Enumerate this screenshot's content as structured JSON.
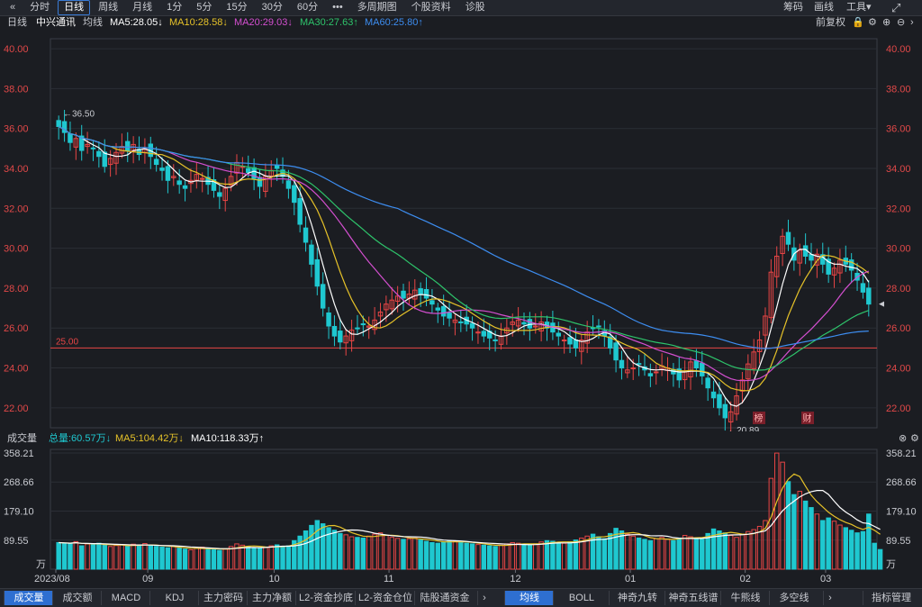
{
  "toolbar": {
    "back_icon": "«",
    "tabs": [
      {
        "label": "分时",
        "active": false
      },
      {
        "label": "日线",
        "active": true
      },
      {
        "label": "周线",
        "active": false
      },
      {
        "label": "月线",
        "active": false
      },
      {
        "label": "1分",
        "active": false
      },
      {
        "label": "5分",
        "active": false
      },
      {
        "label": "15分",
        "active": false
      },
      {
        "label": "30分",
        "active": false
      },
      {
        "label": "60分",
        "active": false
      },
      {
        "label": "•••",
        "active": false
      },
      {
        "label": "多周期图",
        "active": false
      },
      {
        "label": "个股资料",
        "active": false
      },
      {
        "label": "诊股",
        "active": false
      }
    ],
    "right": {
      "chips": "筹码",
      "draw": "画线",
      "tools": "工具▾",
      "expand_icon": "expand-icon"
    }
  },
  "price_header": {
    "period": "日线",
    "stock": "中兴通讯",
    "avg": "均线",
    "ma5": "MA5:28.05↓",
    "ma10": "MA10:28.58↓",
    "ma20": "MA20:29.03↓",
    "ma30": "MA30:27.63↑",
    "ma60": "MA60:25.80↑",
    "adjust": "前复权"
  },
  "volume_header": {
    "title": "成交量",
    "total": "总量:60.57万↓",
    "ma5": "MA5:104.42万↓",
    "ma10": "MA10:118.33万↑"
  },
  "bottom_left_tabs": [
    "成交量",
    "成交额",
    "MACD",
    "KDJ",
    "主力密码",
    "主力净额",
    "L2-资金抄底",
    "L2-资金仓位",
    "陆股通资金"
  ],
  "bottom_right_tabs": [
    "均线",
    "BOLL",
    "神奇九转",
    "神奇五线谱",
    "牛熊线",
    "多空线"
  ],
  "bottom_far_right": "指标管理",
  "colors": {
    "up": "#e84545",
    "down": "#1fc8d0",
    "ma5": "#ffffff",
    "ma10": "#e6c229",
    "ma20": "#d44fd0",
    "ma30": "#2ec46b",
    "ma60": "#3d8df0",
    "bg": "#1b1d22",
    "grid": "#2b2e35",
    "axis_text": "#e04848"
  },
  "chart_data": {
    "type": "candlestick",
    "price_axis": {
      "ticks": [
        "40.00",
        "38.00",
        "36.00",
        "34.00",
        "32.00",
        "30.00",
        "28.00",
        "26.00",
        "24.00",
        "22.00"
      ],
      "range": [
        21.0,
        40.5
      ]
    },
    "volume_axis": {
      "ticks": [
        "358.21",
        "268.66",
        "179.10",
        "89.55"
      ],
      "unit": "万",
      "range": [
        0,
        358.21
      ]
    },
    "x_labels": [
      "2023/08",
      "09",
      "10",
      "11",
      "12",
      "01",
      "02",
      "03"
    ],
    "hline": {
      "value": 25.0,
      "label": "25.00"
    },
    "annotations": {
      "high": "←36.50",
      "low": "←20.89",
      "badge1": "榜",
      "badge2": "财"
    },
    "closes": [
      36.1,
      35.8,
      35.3,
      35.5,
      34.9,
      35.2,
      35.0,
      34.6,
      34.1,
      34.5,
      34.8,
      35.1,
      34.9,
      35.2,
      34.7,
      35.0,
      34.6,
      34.2,
      33.9,
      33.4,
      33.6,
      33.2,
      33.0,
      33.4,
      33.7,
      33.5,
      33.2,
      32.9,
      32.6,
      33.0,
      33.6,
      34.3,
      34.1,
      33.8,
      33.5,
      33.1,
      33.6,
      33.9,
      34.0,
      33.6,
      33.0,
      32.3,
      31.2,
      30.3,
      29.2,
      28.1,
      27.0,
      26.1,
      25.6,
      25.3,
      25.6,
      25.9,
      26.0,
      26.2,
      26.1,
      26.4,
      26.8,
      27.2,
      27.4,
      27.6,
      27.5,
      27.7,
      27.9,
      27.7,
      27.5,
      27.2,
      26.9,
      26.6,
      26.5,
      26.4,
      26.3,
      26.2,
      26.0,
      25.8,
      25.6,
      25.5,
      25.4,
      25.6,
      26.0,
      26.3,
      26.4,
      26.2,
      26.0,
      26.1,
      26.3,
      26.0,
      25.8,
      25.6,
      25.4,
      25.2,
      25.0,
      25.4,
      25.8,
      26.0,
      26.1,
      25.6,
      25.0,
      24.4,
      24.0,
      23.9,
      24.0,
      24.2,
      23.9,
      23.6,
      23.8,
      24.1,
      24.0,
      23.7,
      23.4,
      23.8,
      24.3,
      24.0,
      23.6,
      23.0,
      22.5,
      22.0,
      21.5,
      21.8,
      22.6,
      23.4,
      24.2,
      24.8,
      25.4,
      26.6,
      28.8,
      29.6,
      30.6,
      30.2,
      29.4,
      29.9,
      29.6,
      29.4,
      29.7,
      29.2,
      28.7,
      29.0,
      29.4,
      29.2,
      28.9,
      28.4,
      27.8,
      27.2
    ],
    "volumes": [
      82,
      80,
      79,
      85,
      72,
      78,
      76,
      80,
      74,
      70,
      73,
      75,
      71,
      77,
      72,
      79,
      74,
      70,
      68,
      66,
      70,
      65,
      62,
      60,
      64,
      68,
      63,
      60,
      58,
      62,
      70,
      78,
      74,
      70,
      66,
      64,
      68,
      72,
      75,
      70,
      72,
      88,
      102,
      118,
      135,
      150,
      140,
      128,
      120,
      110,
      106,
      100,
      98,
      96,
      102,
      108,
      112,
      104,
      98,
      95,
      92,
      94,
      96,
      90,
      86,
      82,
      80,
      84,
      88,
      86,
      83,
      80,
      78,
      76,
      74,
      72,
      70,
      74,
      78,
      82,
      80,
      76,
      74,
      78,
      84,
      88,
      86,
      82,
      80,
      84,
      90,
      96,
      102,
      108,
      100,
      94,
      110,
      126,
      118,
      108,
      102,
      96,
      92,
      88,
      94,
      98,
      92,
      88,
      96,
      104,
      100,
      96,
      92,
      110,
      124,
      118,
      112,
      104,
      98,
      108,
      116,
      122,
      132,
      150,
      280,
      358,
      330,
      270,
      230,
      240,
      210,
      190,
      170,
      150,
      158,
      148,
      136,
      128,
      120,
      112,
      116,
      170,
      80,
      60.57
    ]
  }
}
